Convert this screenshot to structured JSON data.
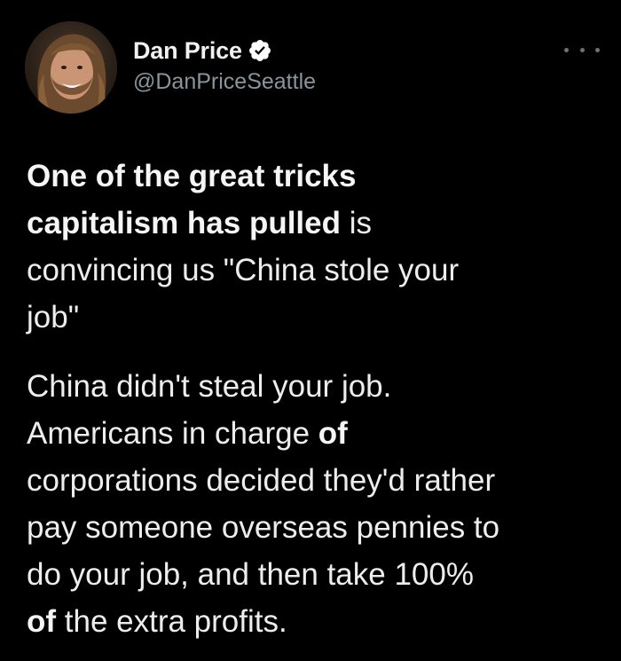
{
  "author": {
    "display_name": "Dan Price",
    "handle": "@DanPriceSeattle",
    "verified": true
  },
  "tweet": {
    "paragraph1": {
      "l1_bold": "One of the great tricks",
      "l2_bold": "capitalism has pulled",
      "l2_rest": " is",
      "l3": "convincing us \"China stole your",
      "l4": "job\""
    },
    "paragraph2": {
      "l1": "China didn't steal your job.",
      "l2_a": "Americans in charge ",
      "l2_bold": "of",
      "l3": "corporations decided they'd rather",
      "l4": "pay someone overseas pennies to",
      "l5": "do your job, and then take 100%",
      "l6_bold": "of",
      "l6_rest": " the extra profits."
    }
  },
  "icons": {
    "verified": "verified-badge-icon",
    "more": "more-options-icon"
  },
  "colors": {
    "background": "#000000",
    "text": "#e7e9ea",
    "secondary": "#8b949b",
    "verified_badge": "#ffffff"
  }
}
